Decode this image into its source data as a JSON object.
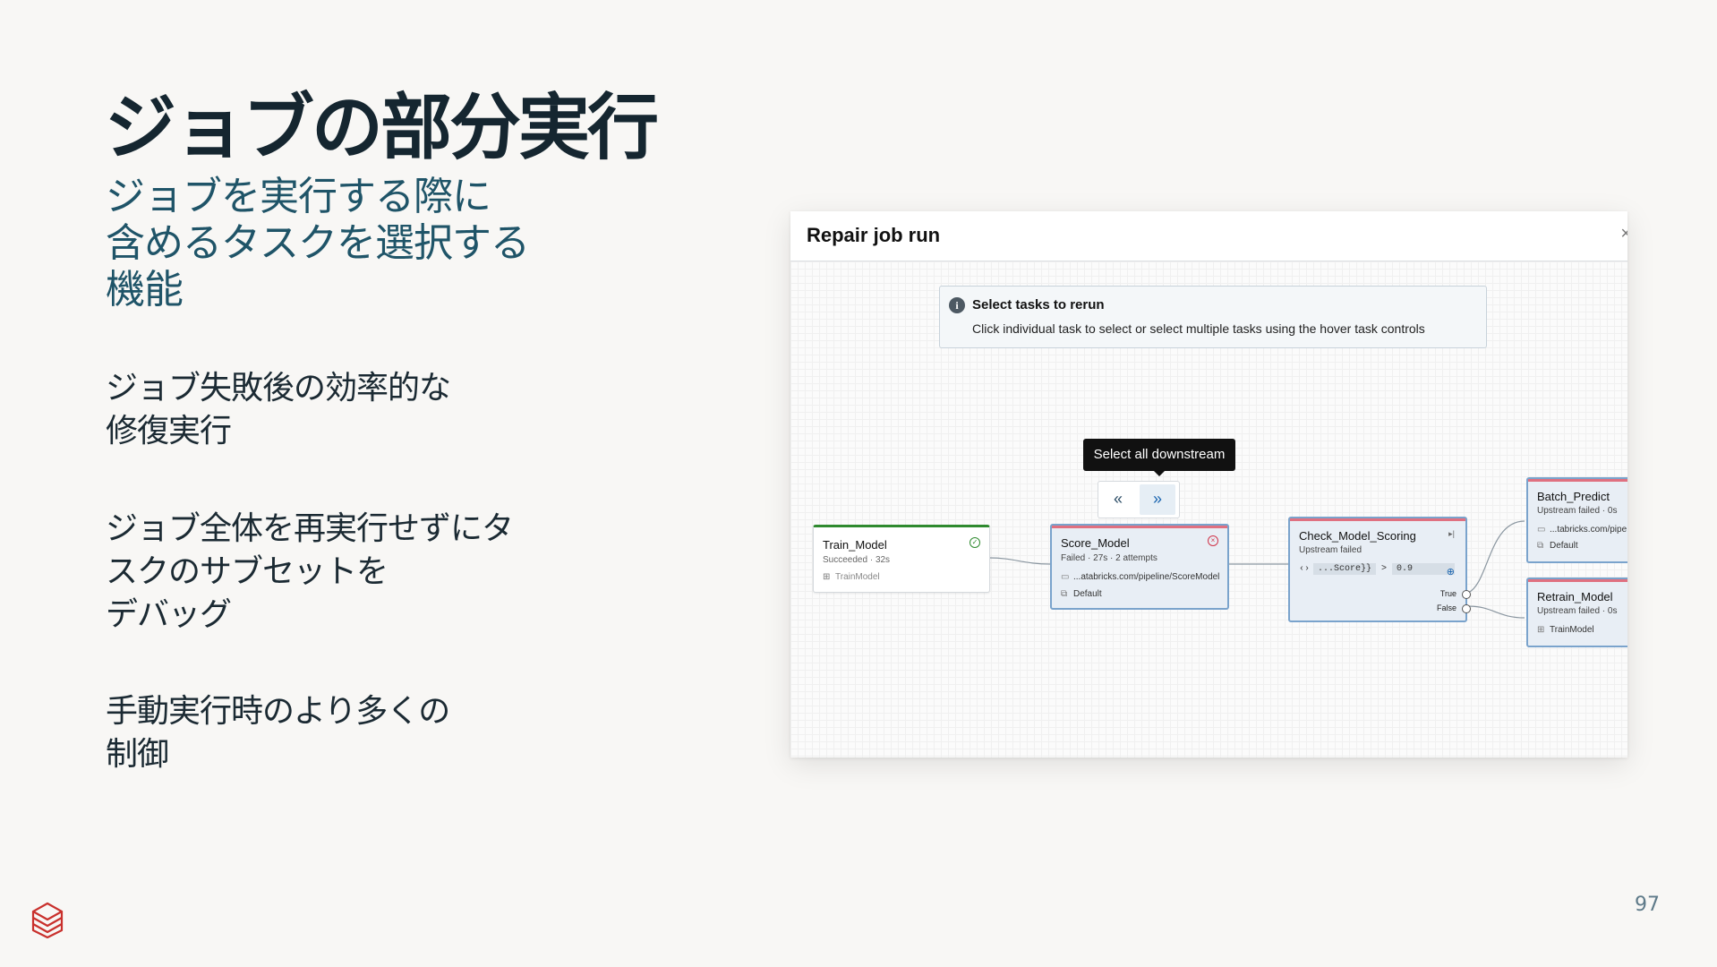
{
  "slide": {
    "title": "ジョブの部分実行",
    "subtitle_lines": [
      "ジョブを実行する際に",
      "含めるタスクを選択する",
      "機能"
    ],
    "bullets": [
      {
        "lines": [
          "ジョブ失敗後の効率的な",
          "修復実行"
        ]
      },
      {
        "lines": [
          "ジョブ全体を再実行せずにタ",
          "スクのサブセットを",
          "デバッグ"
        ]
      },
      {
        "lines": [
          "手動実行時のより多くの",
          "制御"
        ]
      }
    ],
    "page_number": "97",
    "logo_icon": "databricks-logo-icon",
    "colors": {
      "title": "#152630",
      "subtitle": "#1f5468",
      "logo": "#c9302c",
      "success": "#2f8a2f",
      "failed": "#e07080",
      "selected": "#7aa3cc"
    }
  },
  "dialog": {
    "title": "Repair job run",
    "close_label": "×",
    "info": {
      "icon": "info-icon",
      "icon_glyph": "i",
      "title": "Select tasks to rerun",
      "text": "Click individual task to select or select multiple tasks using the hover task controls"
    },
    "tooltip": "Select all downstream",
    "hover_controls": {
      "upstream_label": "«",
      "downstream_label": "»"
    },
    "nodes": {
      "train_model": {
        "name": "Train_Model",
        "status": "Succeeded",
        "duration": "32s",
        "task": "TrainModel"
      },
      "score_model": {
        "name": "Score_Model",
        "status": "Failed",
        "duration": "27s",
        "attempts": "2 attempts",
        "path": "...atabricks.com/pipeline/ScoreModel",
        "cluster": "Default"
      },
      "check_model_scoring": {
        "name": "Check_Model_Scoring",
        "status": "Upstream failed",
        "expr_icon": "‹›",
        "expression": "...Score}}",
        "operator": ">",
        "value": "0.9",
        "true_label": "True",
        "false_label": "False"
      },
      "batch_predict": {
        "name": "Batch_Predict",
        "status": "Upstream failed",
        "duration": "0s",
        "path": "...tabricks.com/pipe",
        "cluster": "Default"
      },
      "retrain_model": {
        "name": "Retrain_Model",
        "status": "Upstream failed",
        "duration": "0s",
        "task": "TrainModel"
      }
    }
  }
}
